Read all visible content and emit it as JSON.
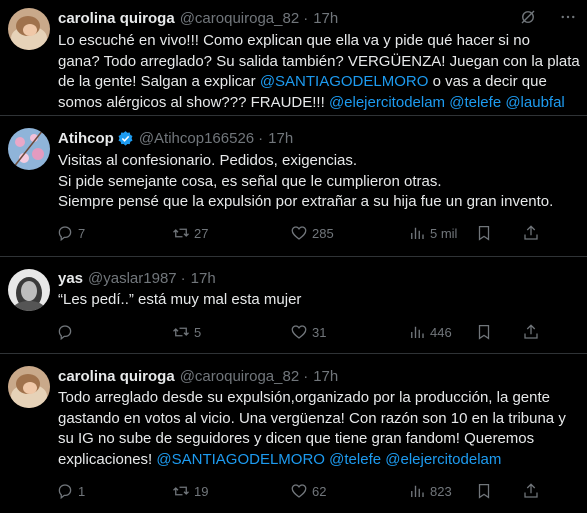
{
  "tweets": [
    {
      "name": "carolina quiroga",
      "handle": "@caroquiroga_82",
      "dot": "·",
      "time": "17h",
      "verified": false,
      "lines": [
        [
          {
            "t": "Lo escuché en vivo!!! Como explican que ella va y pide qué hacer si no"
          }
        ],
        [
          {
            "t": "gana? Todo arreglado? Su salida también? VERGÜENZA! Juegan con la plata"
          }
        ],
        [
          {
            "t": "de la gente! Salgan a explicar "
          },
          {
            "t": "@SANTIAGODELMORO",
            "m": true
          },
          {
            "t": " o vas a decir que"
          }
        ],
        [
          {
            "t": "somos alérgicos al show??? FRAUDE!!! "
          },
          {
            "t": "@elejercitodelam",
            "m": true
          },
          {
            "t": " "
          },
          {
            "t": "@telefe",
            "m": true
          },
          {
            "t": " "
          },
          {
            "t": "@laubfal",
            "m": true
          }
        ]
      ],
      "replies": "",
      "retweets": "",
      "likes": "",
      "views": "",
      "show_actions": false
    },
    {
      "name": "Atihcop",
      "handle": "@Atihcop166526",
      "dot": "·",
      "time": "17h",
      "verified": true,
      "lines": [
        [
          {
            "t": "Visitas al confesionario. Pedidos, exigencias."
          }
        ],
        [
          {
            "t": "Si pide semejante cosa, es señal que le cumplieron otras."
          }
        ],
        [
          {
            "t": "Siempre pensé que la expulsión por extrañar a su hija fue un gran invento."
          }
        ]
      ],
      "replies": "7",
      "retweets": "27",
      "likes": "285",
      "views": "5 mil",
      "show_actions": true
    },
    {
      "name": "yas",
      "handle": "@yaslar1987",
      "dot": "·",
      "time": "17h",
      "verified": false,
      "lines": [
        [
          {
            "t": "“Les pedí..” está muy mal esta mujer"
          }
        ]
      ],
      "replies": "",
      "retweets": "5",
      "likes": "31",
      "views": "446",
      "show_actions": true
    },
    {
      "name": "carolina quiroga",
      "handle": "@caroquiroga_82",
      "dot": "·",
      "time": "17h",
      "verified": false,
      "lines": [
        [
          {
            "t": "Todo arreglado desde su expulsión,organizado por la producción, la gente"
          }
        ],
        [
          {
            "t": "gastando en votos al vicio. Una vergüenza! Con razón son 10 en la tribuna y"
          }
        ],
        [
          {
            "t": "su IG no sube de seguidores y dicen que tiene gran fandom! Queremos"
          }
        ],
        [
          {
            "t": "explicaciones! "
          },
          {
            "t": "@SANTIAGODELMORO",
            "m": true
          },
          {
            "t": " "
          },
          {
            "t": "@telefe",
            "m": true
          },
          {
            "t": " "
          },
          {
            "t": "@elejercitodelam",
            "m": true
          }
        ]
      ],
      "replies": "1",
      "retweets": "19",
      "likes": "62",
      "views": "823",
      "show_actions": true
    }
  ],
  "colors": {
    "background": "#000000",
    "text": "#e7e9ea",
    "muted": "#71767b",
    "mention": "#1d9bf0",
    "divider": "#2f3336",
    "verified": "#1d9bf0"
  }
}
